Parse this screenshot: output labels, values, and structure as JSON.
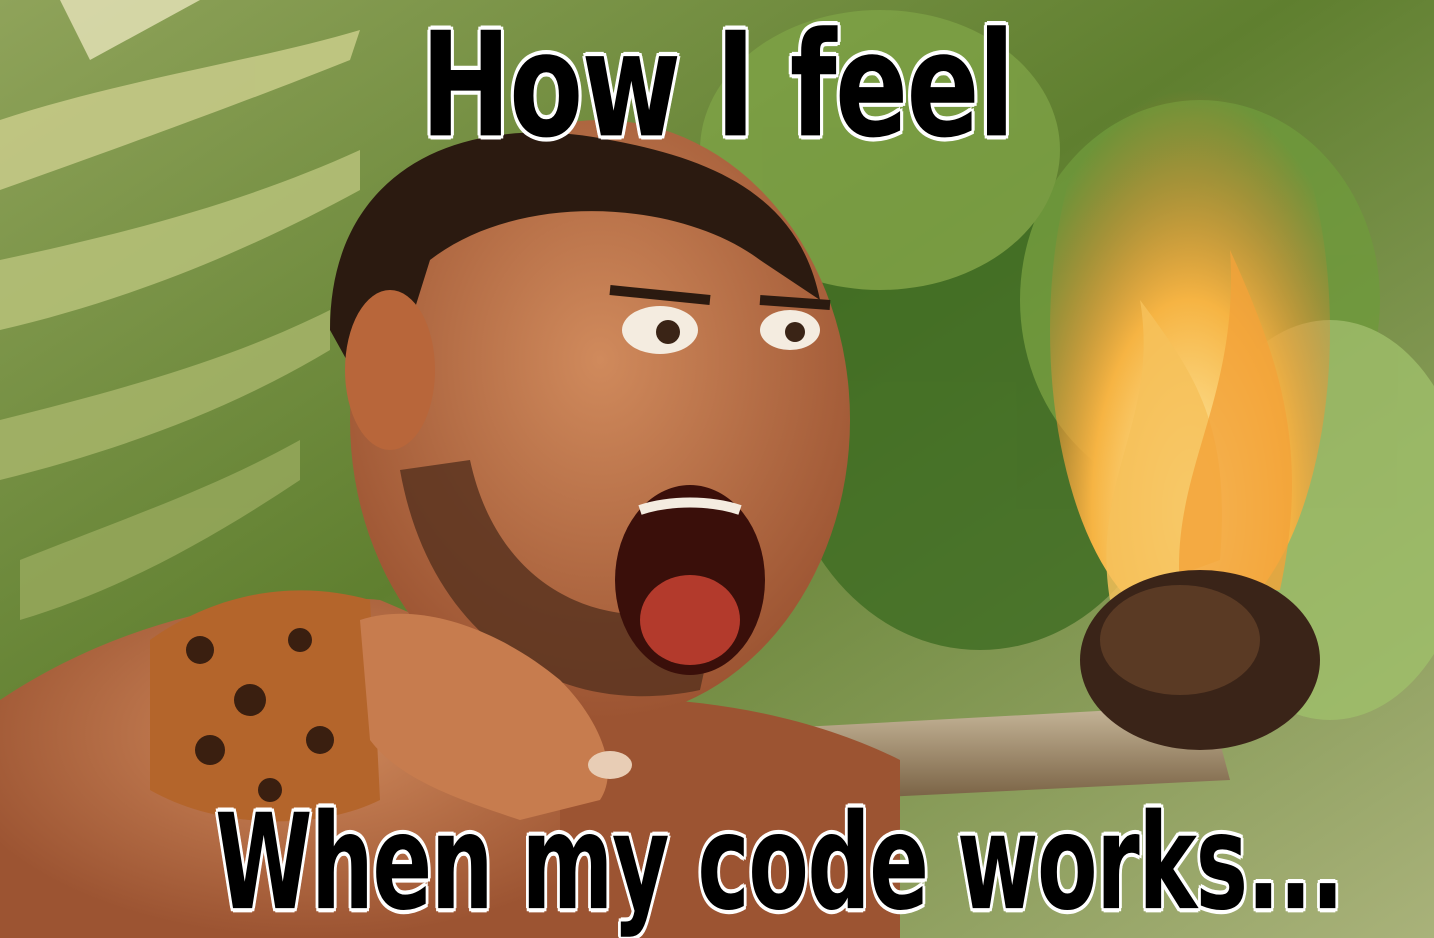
{
  "meme": {
    "top_text": "How I feel",
    "bottom_text": "When my code works..."
  },
  "colors": {
    "caption_fill": "#000000",
    "caption_outline": "#ffffff",
    "foliage": "#6d8a3a",
    "skin": "#b5693f",
    "fire": "#f2a23a"
  }
}
